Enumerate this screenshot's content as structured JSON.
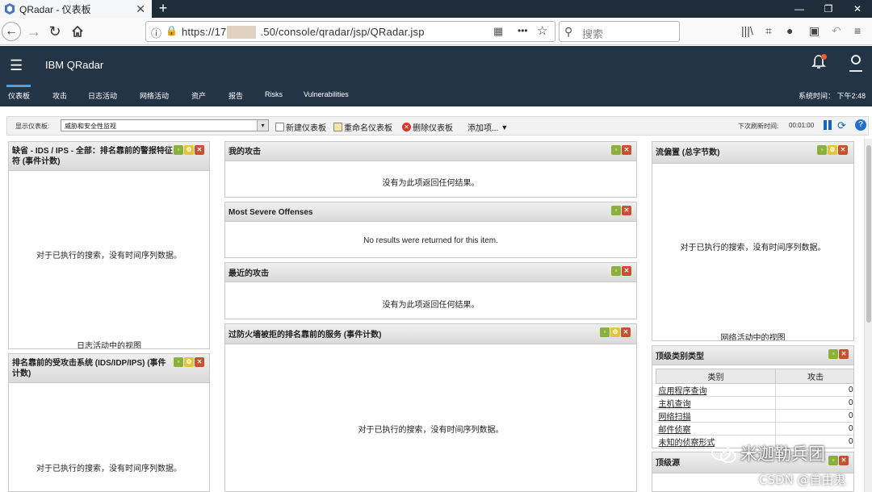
{
  "browser": {
    "tab_title": "QRadar - 仪表板",
    "new_tab": "+",
    "url_prefix": "https://17",
    "url_suffix": ".50/console/qradar/jsp/QRadar.jsp",
    "more": "•••",
    "search_placeholder": "搜索"
  },
  "header": {
    "brand": "IBM QRadar"
  },
  "tabs": [
    {
      "label": "仪表板",
      "active": true
    },
    {
      "label": "攻击"
    },
    {
      "label": "日志活动"
    },
    {
      "label": "网络活动"
    },
    {
      "label": "资产"
    },
    {
      "label": "报告"
    },
    {
      "label": "Risks"
    },
    {
      "label": "Vulnerabilities"
    }
  ],
  "system_time": "系统时间： 下午2:48",
  "toolbar": {
    "show_dashboard_label": "显示仪表板:",
    "selected_dashboard": "威胁和安全性监视",
    "new_dashboard": "新建仪表板",
    "rename_dashboard": "重命名仪表板",
    "delete_dashboard": "删除仪表板",
    "add_item": "添加项...",
    "next_refresh_label": "下次刷新时间:",
    "next_refresh_value": "00:01:00"
  },
  "panels": {
    "p1": {
      "title": "缺省 - IDS / IPS - 全部：排名靠前的警报特征符 (事件计数)",
      "message": "对于已执行的搜索，没有时间序列数据。",
      "link": "日志活动中的视图"
    },
    "p2": {
      "title": "排名靠前的受攻击系统 (IDS/IDP/IPS) (事件计数)",
      "message": "对于已执行的搜索，没有时间序列数据。"
    },
    "p3": {
      "title": "我的攻击",
      "message": "没有为此项返回任何结果。"
    },
    "p4": {
      "title": "Most Severe Offenses",
      "message": "No results were returned for this item."
    },
    "p5": {
      "title": "最近的攻击",
      "message": "没有为此项返回任何结果。"
    },
    "p6": {
      "title": "过防火墙被拒的排名靠前的服务 (事件计数)",
      "message": "对于已执行的搜索，没有时间序列数据。"
    },
    "p7": {
      "title": "流偏置 (总字节数)",
      "message": "对于已执行的搜索，没有时间序列数据。",
      "link": "网络活动中的视图"
    },
    "p8": {
      "title": "顶级类别类型",
      "col_category": "类别",
      "col_offenses": "攻击",
      "rows": [
        {
          "category": "应用程序查询",
          "count": "0"
        },
        {
          "category": "主机查询",
          "count": "0"
        },
        {
          "category": "网络扫描",
          "count": "0"
        },
        {
          "category": "邮件侦察",
          "count": "0"
        },
        {
          "category": "未知的侦察形式",
          "count": "0"
        }
      ]
    },
    "p9": {
      "title": "顶级源"
    }
  },
  "watermark": {
    "line1": "米迦勒兵团",
    "line2": "CSDN @自由鬼"
  }
}
